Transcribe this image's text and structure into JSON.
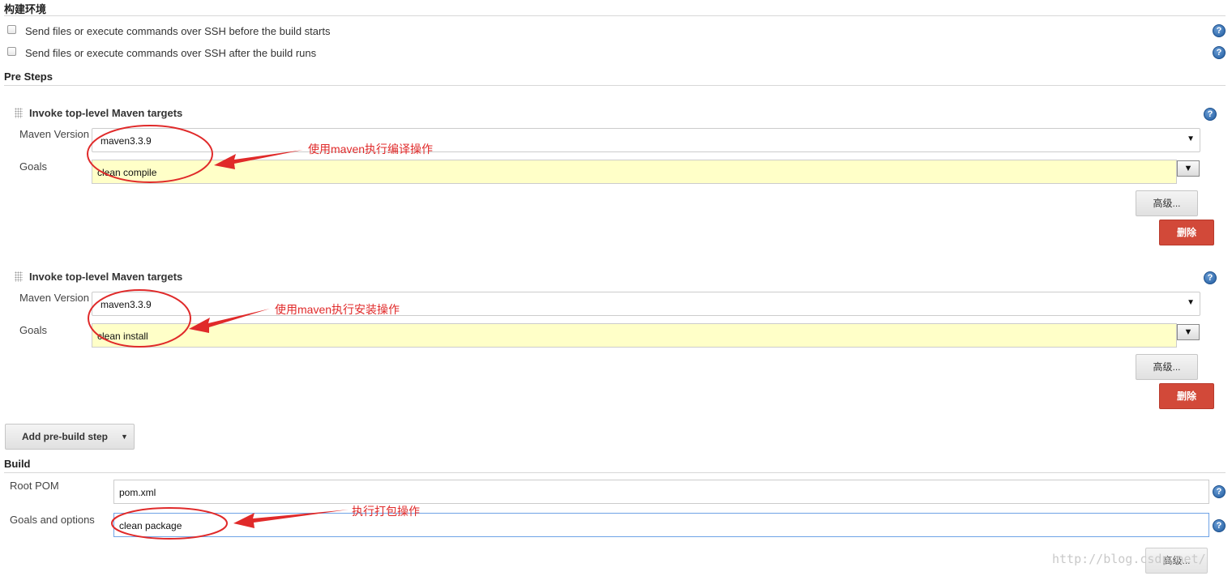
{
  "build_env": {
    "title": "构建环境",
    "options": [
      {
        "label": "Send files or execute commands over SSH before the build starts"
      },
      {
        "label": "Send files or execute commands over SSH after the build runs"
      }
    ]
  },
  "pre_steps": {
    "title": "Pre Steps",
    "steps": [
      {
        "title": "Invoke top-level Maven targets",
        "maven_version_label": "Maven Version",
        "maven_version": "maven3.3.9",
        "goals_label": "Goals",
        "goals": "clean compile",
        "advanced_label": "高级...",
        "delete_label": "删除",
        "annotation": "使用maven执行编译操作"
      },
      {
        "title": "Invoke top-level Maven targets",
        "maven_version_label": "Maven Version",
        "maven_version": "maven3.3.9",
        "goals_label": "Goals",
        "goals": "clean install",
        "advanced_label": "高级...",
        "delete_label": "删除",
        "annotation": "使用maven执行安装操作"
      }
    ],
    "add_step_label": "Add pre-build step"
  },
  "build": {
    "title": "Build",
    "root_pom_label": "Root POM",
    "root_pom": "pom.xml",
    "goals_label": "Goals and options",
    "goals": "clean package",
    "annotation": "执行打包操作",
    "advanced_label": "高级..."
  },
  "watermark": "http://blog.csdn.net/",
  "icons": {
    "help": "help-icon",
    "drag": "drag-handle-icon",
    "dropdown": "caret-down-icon"
  },
  "colors": {
    "annotation": "#e02a2a",
    "delete_button": "#d24939",
    "goals_background": "#ffffc8",
    "help_icon": "#2a66ad"
  }
}
